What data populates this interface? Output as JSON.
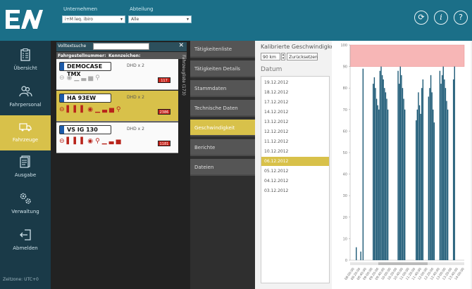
{
  "header": {
    "unternehmen_label": "Unternehmen",
    "unternehmen_value": "i+M leq. ibiro",
    "abteilung_label": "Abteilung",
    "abteilung_value": "Alle",
    "icons": [
      "refresh-icon",
      "info-icon",
      "help-icon"
    ]
  },
  "nav": {
    "items": [
      {
        "label": "Übersicht",
        "icon": "clipboard-icon"
      },
      {
        "label": "Fahrpersonal",
        "icon": "people-icon"
      },
      {
        "label": "Fahrzeuge",
        "icon": "truck-icon"
      },
      {
        "label": "Ausgabe",
        "icon": "document-icon"
      },
      {
        "label": "Verwaltung",
        "icon": "gears-icon"
      },
      {
        "label": "Abmelden",
        "icon": "logout-icon"
      }
    ],
    "footer": "Zeitzone: UTC+0"
  },
  "vehicles": {
    "search_label": "Volltextsuche",
    "side_label": "Fahrzeugliste (173)",
    "columns": [
      "Fahrgestellnummer:",
      "Kennzeichen:"
    ],
    "rows": [
      {
        "plate": "DEMOCASE TMX",
        "type": "DHD x 2",
        "count": "117",
        "selected": false
      },
      {
        "plate": "HA 93EW",
        "type": "DHD x 2",
        "count": "2386",
        "selected": true
      },
      {
        "plate": "VS IG 130",
        "type": "DHD x 2",
        "count": "1181",
        "selected": false
      }
    ]
  },
  "menu": {
    "items": [
      "Tätigkeitenliste",
      "Tätigkeiten Details",
      "Stammdaten",
      "Technische Daten",
      "Geschwindigkeit",
      "Berichte",
      "Dateien"
    ],
    "active_index": 4
  },
  "content": {
    "title": "Kalibrierte Geschwindigkeit",
    "speed_value": "90 km",
    "reset_label": "Zurücksetzen",
    "dates_label": "Datum",
    "dates": [
      "19.12.2012",
      "18.12.2012",
      "17.12.2012",
      "14.12.2012",
      "13.12.2012",
      "12.12.2012",
      "11.12.2012",
      "10.12.2012",
      "06.12.2012",
      "05.12.2012",
      "04.12.2012",
      "03.12.2012"
    ],
    "selected_date_index": 8
  },
  "chart_data": {
    "type": "bar",
    "ylim": [
      0,
      100
    ],
    "yticks": [
      0,
      10,
      20,
      30,
      40,
      50,
      60,
      70,
      80,
      90,
      100
    ],
    "threshold_band": [
      90,
      100
    ],
    "x_tick_labels": [
      "08:00:00",
      "08:20:00",
      "08:40:00",
      "09:00:00",
      "09:20:00",
      "09:40:00",
      "10:00:00",
      "10:20:00",
      "10:40:00",
      "11:00:00",
      "11:20:00",
      "11:40:00",
      "12:00:00",
      "12:20:00",
      "12:40:00",
      "13:00:00",
      "13:20:00",
      "13:40:00",
      "14:00:00"
    ],
    "values": [
      0,
      0,
      0,
      0,
      0,
      6,
      0,
      0,
      0,
      4,
      0,
      89,
      0,
      0,
      0,
      0,
      0,
      0,
      0,
      0,
      82,
      85,
      80,
      75,
      72,
      70,
      88,
      90,
      86,
      84,
      80,
      78,
      75,
      70,
      0,
      0,
      0,
      0,
      0,
      0,
      0,
      0,
      88,
      82,
      90,
      86,
      80,
      75,
      70,
      0,
      0,
      0,
      0,
      0,
      0,
      0,
      0,
      0,
      65,
      70,
      78,
      72,
      68,
      80,
      84,
      0,
      0,
      0,
      0,
      76,
      80,
      86,
      78,
      70,
      64,
      0,
      0,
      0,
      0,
      88,
      82,
      86,
      90,
      84,
      80,
      74,
      70,
      0,
      0,
      0,
      0,
      84,
      90,
      0,
      0,
      0,
      0,
      0,
      0,
      0,
      0
    ],
    "bar_color": "#1d5a76",
    "band_color": "#f7b6b6"
  }
}
